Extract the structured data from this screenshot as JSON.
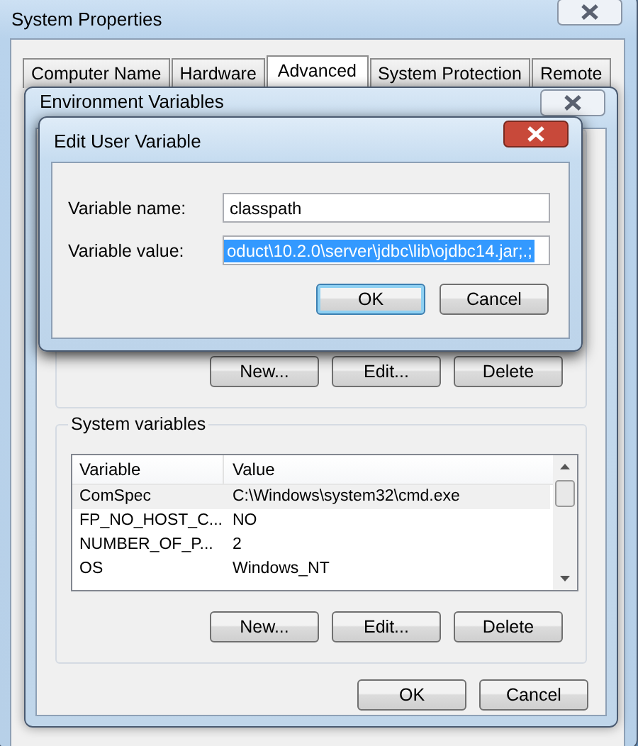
{
  "system_properties": {
    "title": "System Properties",
    "tabs": [
      {
        "label": "Computer Name",
        "selected": false
      },
      {
        "label": "Hardware",
        "selected": false
      },
      {
        "label": "Advanced",
        "selected": true
      },
      {
        "label": "System Protection",
        "selected": false
      },
      {
        "label": "Remote",
        "selected": false
      }
    ]
  },
  "environment_variables": {
    "title": "Environment Variables",
    "user_variable_buttons": [
      "New...",
      "Edit...",
      "Delete"
    ],
    "system_variables": {
      "label": "System variables",
      "columns": [
        "Variable",
        "Value"
      ],
      "rows": [
        {
          "variable": "ComSpec",
          "value": "C:\\Windows\\system32\\cmd.exe",
          "selected": true
        },
        {
          "variable": "FP_NO_HOST_C...",
          "value": "NO",
          "selected": false
        },
        {
          "variable": "NUMBER_OF_P...",
          "value": "2",
          "selected": false
        },
        {
          "variable": "OS",
          "value": "Windows_NT",
          "selected": false
        }
      ],
      "buttons": [
        "New...",
        "Edit...",
        "Delete"
      ]
    },
    "buttons": [
      "OK",
      "Cancel"
    ]
  },
  "edit_user_variable": {
    "title": "Edit User Variable",
    "fields": [
      {
        "label": "Variable name:",
        "value": "classpath",
        "text_selected": false
      },
      {
        "label": "Variable value:",
        "value": "oduct\\10.2.0\\server\\jdbc\\lib\\ojdbc14.jar;.;",
        "text_selected": true
      }
    ],
    "buttons": [
      {
        "label": "OK",
        "default": true
      },
      {
        "label": "Cancel",
        "default": false
      }
    ]
  }
}
